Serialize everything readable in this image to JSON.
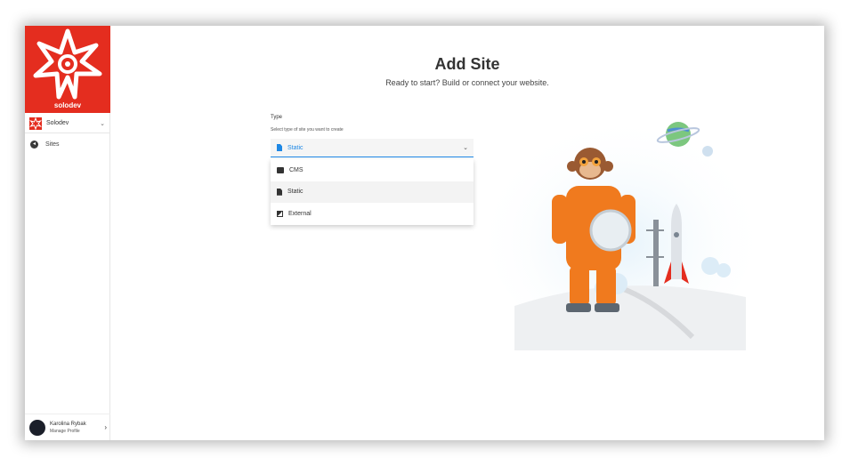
{
  "brand": {
    "name": "solodev",
    "color": "#e42d1f"
  },
  "sidebar": {
    "org": {
      "label": "Solodev"
    },
    "items": [
      {
        "label": "Sites",
        "icon": "arrow-left-circle-icon"
      }
    ],
    "profile": {
      "name": "Karolina Rybak",
      "subtitle": "Manage Profile"
    }
  },
  "main": {
    "title": "Add Site",
    "subtitle": "Ready to start? Build or connect your website.",
    "type_field": {
      "label": "Type",
      "help": "Select type of site you want to create",
      "selected": "Static",
      "options": [
        {
          "label": "CMS",
          "icon": "database-icon"
        },
        {
          "label": "Static",
          "icon": "document-icon"
        },
        {
          "label": "External",
          "icon": "external-icon"
        }
      ]
    }
  },
  "colors": {
    "accent": "#1e88e5"
  }
}
